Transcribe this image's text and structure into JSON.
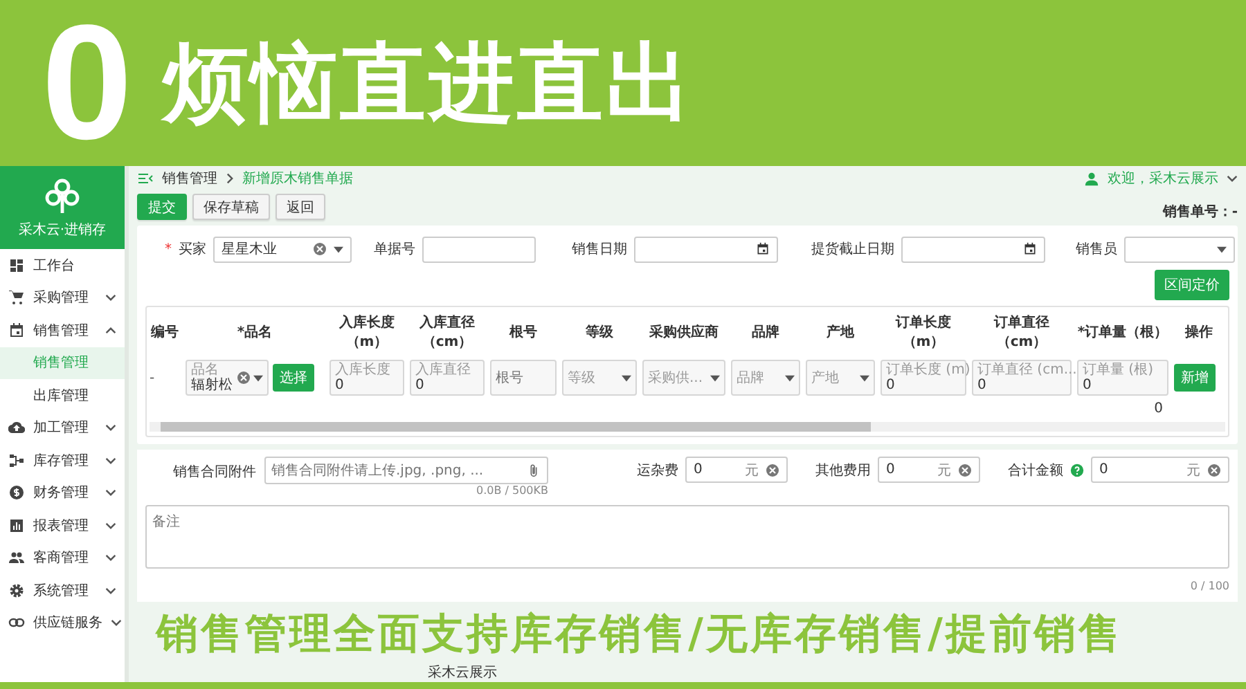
{
  "banner": {
    "digit": "0",
    "headline": "烦恼直进直出"
  },
  "sidebar": {
    "app_name": "采木云·进销存",
    "items": [
      {
        "label": "工作台",
        "kind": "link",
        "selected": false
      },
      {
        "label": "采购管理",
        "kind": "group",
        "expanded": false,
        "selected": false
      },
      {
        "label": "销售管理",
        "kind": "group",
        "expanded": true,
        "selected": false,
        "children": [
          {
            "label": "销售管理",
            "selected": true
          },
          {
            "label": "出库管理",
            "selected": false
          }
        ]
      },
      {
        "label": "加工管理",
        "kind": "group",
        "expanded": false,
        "selected": false
      },
      {
        "label": "库存管理",
        "kind": "group",
        "expanded": false,
        "selected": false
      },
      {
        "label": "财务管理",
        "kind": "group",
        "expanded": false,
        "selected": false
      },
      {
        "label": "报表管理",
        "kind": "group",
        "expanded": false,
        "selected": false
      },
      {
        "label": "客商管理",
        "kind": "group",
        "expanded": false,
        "selected": false
      },
      {
        "label": "系统管理",
        "kind": "group",
        "expanded": false,
        "selected": false
      },
      {
        "label": "供应链服务",
        "kind": "group",
        "expanded": false,
        "selected": false
      }
    ]
  },
  "header": {
    "breadcrumb": [
      "销售管理",
      "新增原木销售单据"
    ],
    "user": "欢迎，采木云展示"
  },
  "toolbar": {
    "buttons": [
      {
        "label": "提交",
        "kind": "primary"
      },
      {
        "label": "保存草稿",
        "kind": "default"
      },
      {
        "label": "返回",
        "kind": "default"
      }
    ],
    "order_number": "销售单号：-"
  },
  "form": {
    "fields": [
      {
        "kind": "select",
        "label": "买家",
        "required_mark": "*",
        "value": "星星木业",
        "clearable": true
      },
      {
        "kind": "text",
        "label": "单据号"
      },
      {
        "kind": "date",
        "label": "销售日期"
      },
      {
        "kind": "date",
        "label": "提货截止日期"
      },
      {
        "kind": "select",
        "label": "销售员",
        "clearable": false
      }
    ],
    "pricing_button": "区间定价"
  },
  "table": {
    "columns": [
      "编号",
      "*品名",
      "入库长度（m）",
      "入库直径（cm）",
      "根号",
      "等级",
      "采购供应商",
      "品牌",
      "产地",
      "订单长度（m）",
      "订单直径（cm）",
      "*订单量（根）",
      "操作"
    ],
    "rows": [
      {
        "cells": [
          {
            "kind": "text",
            "value": "-"
          },
          {
            "kind": "picker",
            "label": "品名",
            "value": "辐射松",
            "button": "选择"
          },
          {
            "kind": "input",
            "label": "入库长度",
            "value": "0"
          },
          {
            "kind": "input",
            "label": "入库直径",
            "value": "0"
          },
          {
            "kind": "plain",
            "placeholder": "根号"
          },
          {
            "kind": "select",
            "placeholder": "等级"
          },
          {
            "kind": "select",
            "placeholder": "采购供..."
          },
          {
            "kind": "select",
            "placeholder": "品牌"
          },
          {
            "kind": "select",
            "placeholder": "产地"
          },
          {
            "kind": "input",
            "label": "订单长度 (m)",
            "value": "0"
          },
          {
            "kind": "input",
            "label": "订单直径 (cm...",
            "value": "0"
          },
          {
            "kind": "input",
            "label": "订单量 (根)",
            "value": "0"
          },
          {
            "kind": "button",
            "label": "新增"
          }
        ]
      }
    ],
    "summary_total": "0"
  },
  "attachment": {
    "label": "销售合同附件",
    "placeholder": "销售合同附件请上传.jpg, .png, ...",
    "size": "0.0B / 500KB"
  },
  "fees": [
    {
      "label": "运杂费",
      "value": "0",
      "unit": "元",
      "help": false
    },
    {
      "label": "其他费用",
      "value": "0",
      "unit": "元",
      "help": false
    },
    {
      "label": "合计金额",
      "value": "0",
      "unit": "元",
      "help": true
    }
  ],
  "remarks": {
    "placeholder": "备注",
    "counter": "0 / 100"
  },
  "slogan": "销售管理全面支持库存销售/无库存销售/提前销售",
  "footer": {
    "value": "采木云展示"
  }
}
